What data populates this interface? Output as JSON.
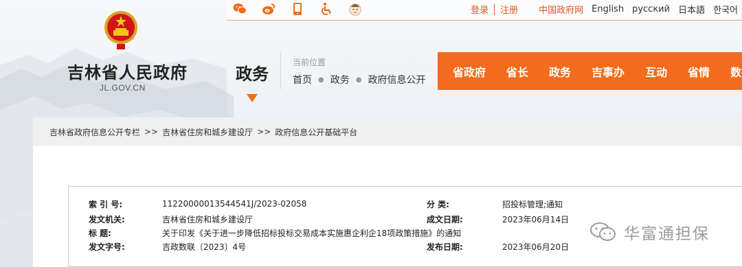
{
  "topbar": {
    "icons": [
      "wechat-icon",
      "weibo-icon",
      "mobile-icon",
      "accessibility-icon",
      "mascot-icon"
    ],
    "login": "登录",
    "register": "注册",
    "gov_portal": "中国政府网",
    "languages": [
      "English",
      "русский",
      "日本語",
      "한국어"
    ]
  },
  "header": {
    "site_title": "吉林省人民政府",
    "site_domain": "JL.GOV.CN",
    "section": "政务",
    "location_label": "当前位置",
    "location_path": [
      "首页",
      "政务",
      "政府信息公开"
    ]
  },
  "nav": [
    "省政府",
    "省长",
    "政务",
    "吉事办",
    "互动",
    "省情",
    "数据"
  ],
  "crumbs": [
    "吉林省政府信息公开专栏",
    "吉林省住房和城乡建设厅",
    "政府信息公开基础平台"
  ],
  "crumb_sep": ">>",
  "document": {
    "index_label": "索 引 号:",
    "index_value": "11220000013544541J/2023-02058",
    "category_label": "分  类:",
    "category_value": "招投标管理;通知",
    "issuer_label": "发文机关:",
    "issuer_value": "吉林省住房和城乡建设厅",
    "created_label": "成文日期:",
    "created_value": "2023年06月14日",
    "title_label": "标    题:",
    "title_value": "关于印发《关于进一步降低招标投标交易成本实施惠企利企18项政策措施》的通知",
    "docno_label": "发文字号:",
    "docno_value": "吉政数联〔2023〕4号",
    "published_label": "发布日期:",
    "published_value": "2023年06月20日"
  },
  "watermark": {
    "text": "华富通担保"
  },
  "colors": {
    "accent": "#f36b1c",
    "link_orange": "#e0571a"
  }
}
